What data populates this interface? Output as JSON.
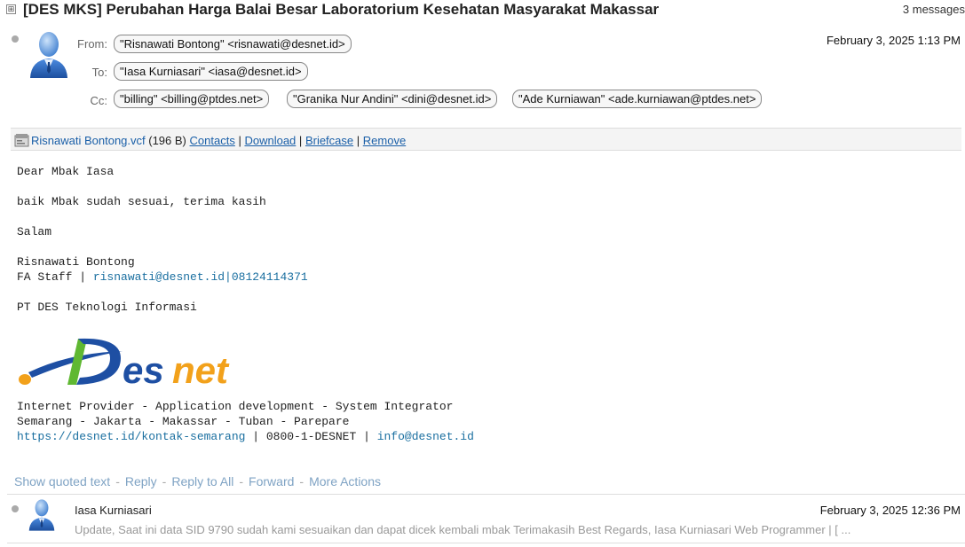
{
  "thread": {
    "expand_glyph": "⊞",
    "subject": "[DES MKS] Perubahan Harga Balai Besar Laboratorium Kesehatan Masyarakat Makassar",
    "message_count": "3 messages"
  },
  "message1": {
    "from_label": "From:",
    "to_label": "To:",
    "cc_label": "Cc:",
    "from": "\"Risnawati Bontong\" <risnawati@desnet.id>",
    "to": "\"Iasa Kurniasari\" <iasa@desnet.id>",
    "cc": [
      "\"billing\" <billing@ptdes.net>",
      "\"Granika Nur Andini\" <dini@desnet.id>",
      "\"Ade Kurniawan\" <ade.kurniawan@ptdes.net>"
    ],
    "date": "February 3, 2025 1:13 PM",
    "attachment": {
      "icon": "vcard-icon",
      "name": "Risnawati Bontong.vcf",
      "size": "(196 B)",
      "contacts": "Contacts",
      "download": "Download",
      "briefcase": "Briefcase",
      "remove": "Remove",
      "separator": "|"
    },
    "body": {
      "greeting": "Dear Mbak Iasa",
      "line1": "baik Mbak sudah sesuai, terima kasih",
      "closing": "Salam",
      "sender_name": "Risnawati Bontong",
      "title_prefix": "FA Staff | ",
      "email_phone": "risnawati@desnet.id|08124114371",
      "company": "PT DES Teknologi Informasi",
      "logo_text": "Desnet",
      "tagline1": "Internet Provider - Application development - System Integrator",
      "tagline2": "Semarang - Jakarta - Makassar - Tuban - Parepare",
      "site_link": "https://desnet.id/kontak-semarang",
      "phone_sep": " | 0800-1-DESNET | ",
      "info_email": "info@desnet.id"
    },
    "actions": [
      "Show quoted text",
      "Reply",
      "Reply to All",
      "Forward",
      "More Actions"
    ],
    "action_sep": "-"
  },
  "message2": {
    "name": "Iasa Kurniasari",
    "date": "February 3, 2025 12:36 PM",
    "snippet": "Update, Saat ini data SID 9790 sudah kami sesuaikan dan dapat dicek kembali mbak Terimakasih Best Regards, Iasa Kurniasari Web Programmer | [ ..."
  },
  "colors": {
    "link": "#1a5fa8",
    "action_link": "#7fa3c4",
    "logo_blue": "#1e4fa3",
    "logo_green": "#5fb832",
    "logo_orange": "#f2a11b"
  }
}
